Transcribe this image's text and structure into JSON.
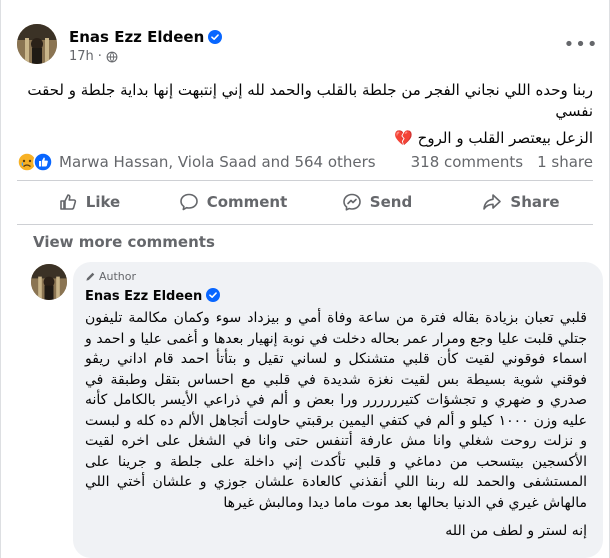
{
  "post": {
    "author": "Enas Ezz Eldeen",
    "time": "17h",
    "text_lines": [
      "ربنا وحده اللي نجاني الفجر من جلطة بالقلب والحمد لله إني إنتبهت إنها بداية جلطة و لحقت نفسي",
      "الزعل بيعتصر القلب و الروح 💔"
    ],
    "reactions": {
      "names": "Marwa Hassan, Viola Saad and 564 others",
      "comments": "318 comments",
      "shares": "1 share"
    },
    "actions": {
      "like": "Like",
      "comment": "Comment",
      "send": "Send",
      "share": "Share"
    },
    "view_more": "View more comments"
  },
  "comment": {
    "badge": "Author",
    "author": "Enas Ezz Eldeen",
    "text": "قلبي تعبان بزيادة بقاله فترة من ساعة وفاة أمي و بيزداد سوء وكمان مكالمة تليفون جتلي قلبت عليا وجع ومرار عمر بحاله دخلت في نوبة إنهيار بعدها و أغمى عليا و احمد و اسماء فوقوني لقيت كأن قلبي متشنكل و لساني تقيل و بتأتأ احمد قام اداني ريڤو فوقني شوية بسيطة بس لقيت نغزة شديدة في قلبي مع احساس بتقل وطبقة في صدري و ضهري و تجشؤات كتيرررررر ورا بعض و ألم في ذراعي الأيسر بالكامل كأنه عليه وزن ١٠٠٠ كيلو و ألم في كتفي اليمين برقبتي حاولت أتجاهل الألم ده كله و لبست و نزلت روحت شغلي وانا مش عارفة أتنفس حتى وانا في الشغل على اخره لقيت الأكسجين بيتسحب من دماغي و قلبي تأكدت إني داخلة على جلطة و جرينا على المستشفى والحمد لله ربنا اللي أنقذني كالعادة علشان جوزي و علشان أختي اللي مالهاش غيري في الدنيا بحالها بعد موت ماما ديدا ومالبش غيرها",
    "text2": "إنه لستر و لطف من الله"
  },
  "colors": {
    "verified": "#0866ff",
    "like_blue": "#0866ff",
    "sad_yellow": "#f7b125",
    "secondary_text": "#65676b"
  },
  "icons": [
    "verified-badge-icon",
    "globe-icon",
    "more-options-icon",
    "sad-reaction-icon",
    "like-reaction-icon",
    "like-icon",
    "comment-icon",
    "send-icon",
    "share-icon",
    "author-pen-icon"
  ]
}
